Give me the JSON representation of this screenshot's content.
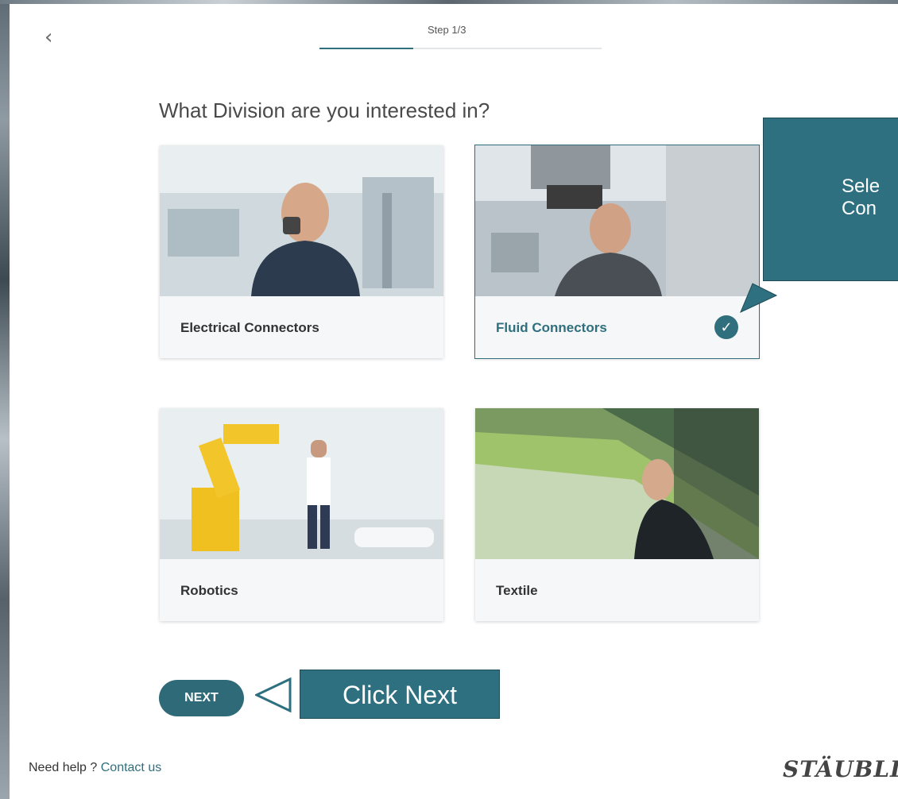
{
  "header": {
    "back_icon": "chevron-left-icon",
    "back_glyph": "‹",
    "step_label": "Step 1/3",
    "progress_fraction": 0.333
  },
  "question": "What Division are you interested in?",
  "divisions": [
    {
      "label": "Electrical Connectors",
      "selected": false
    },
    {
      "label": "Fluid Connectors",
      "selected": true,
      "check_icon": "check-circle-icon"
    },
    {
      "label": "Robotics",
      "selected": false
    },
    {
      "label": "Textile",
      "selected": false
    }
  ],
  "callout": {
    "line1": "Sele",
    "line2": "Con",
    "color": "#2e7080"
  },
  "next_button": {
    "label": "NEXT"
  },
  "hint": {
    "label": "Click Next"
  },
  "footer": {
    "help_text": "Need help ? ",
    "contact_link": "Contact us",
    "logo": "STÄUBLI"
  },
  "colors": {
    "accent": "#2f6f7e"
  }
}
